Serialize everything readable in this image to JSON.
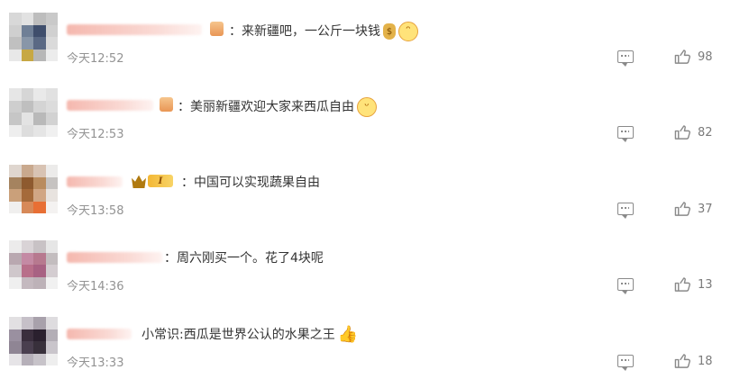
{
  "comments": [
    {
      "text": "：来新疆吧，一公斤一块钱",
      "time": "今天12:52",
      "likes": "98",
      "badge": "small",
      "emojis": [
        "moneybag-emoji",
        "grin-emoji"
      ],
      "avatar_colors": [
        "#d8d8d8",
        "#e2e2e2",
        "#bdbdbd",
        "#c9c9c9",
        "#cfcfcf",
        "#6f7f96",
        "#3f4e6c",
        "#d0d0d0",
        "#c0c0c0",
        "#8896a8",
        "#5a6984",
        "#dadada",
        "#e8e8e8",
        "#c7a843",
        "#b7b7b7",
        "#ececec"
      ]
    },
    {
      "text": "：美丽新疆欢迎大家来西瓜自由",
      "time": "今天12:53",
      "likes": "82",
      "badge": "small",
      "emojis": [
        "smile-emoji"
      ],
      "avatar_colors": [
        "#e6e6e6",
        "#d6d6d6",
        "#e9e9e9",
        "#e1e1e1",
        "#cecece",
        "#bfbfbf",
        "#d4d4d4",
        "#dcdcdc",
        "#c6c6c6",
        "#e3e3e3",
        "#b9b9b9",
        "#d2d2d2",
        "#eeeeee",
        "#dddddd",
        "#e5e5e5",
        "#f0f0f0"
      ]
    },
    {
      "text": "：中国可以实现蔬果自由",
      "time": "今天13:58",
      "likes": "37",
      "badge": "level",
      "badge_level": "I",
      "emojis": [],
      "avatar_colors": [
        "#dfd6cf",
        "#c9a98e",
        "#d8c3b3",
        "#ecebea",
        "#a5835f",
        "#8e5a2f",
        "#b98c5f",
        "#c6c3c1",
        "#caa07a",
        "#a56a3a",
        "#d1a684",
        "#e8e3df",
        "#f0efee",
        "#d78958",
        "#e86f34",
        "#f4f2f1"
      ]
    },
    {
      "text": "：周六刚买一个。花了4块呢",
      "time": "今天14:36",
      "likes": "13",
      "badge": "none",
      "emojis": [],
      "avatar_colors": [
        "#ecebeb",
        "#d9d3d6",
        "#c8c2c5",
        "#e6e6e6",
        "#b9a8b0",
        "#c48aa4",
        "#b7798f",
        "#c3bdbf",
        "#cfc7cb",
        "#b86f8a",
        "#a86283",
        "#d4cdd1",
        "#efefef",
        "#c4b9bf",
        "#bdb2b8",
        "#f1f1f1"
      ]
    },
    {
      "text": "小常识:西瓜是世界公认的水果之王",
      "time": "今天13:33",
      "likes": "18",
      "badge": "none",
      "emojis": [
        "thumbs-up-emoji"
      ],
      "avatar_colors": [
        "#e2e0e2",
        "#c6c0c8",
        "#a8a1ab",
        "#dedcdf",
        "#9a90a0",
        "#3a2e3d",
        "#2a202e",
        "#b3aeb6",
        "#8f8594",
        "#4a3f4f",
        "#38303b",
        "#c9c5cb",
        "#e6e4e7",
        "#b6b0b9",
        "#c7c3c9",
        "#eeeeee"
      ]
    }
  ]
}
